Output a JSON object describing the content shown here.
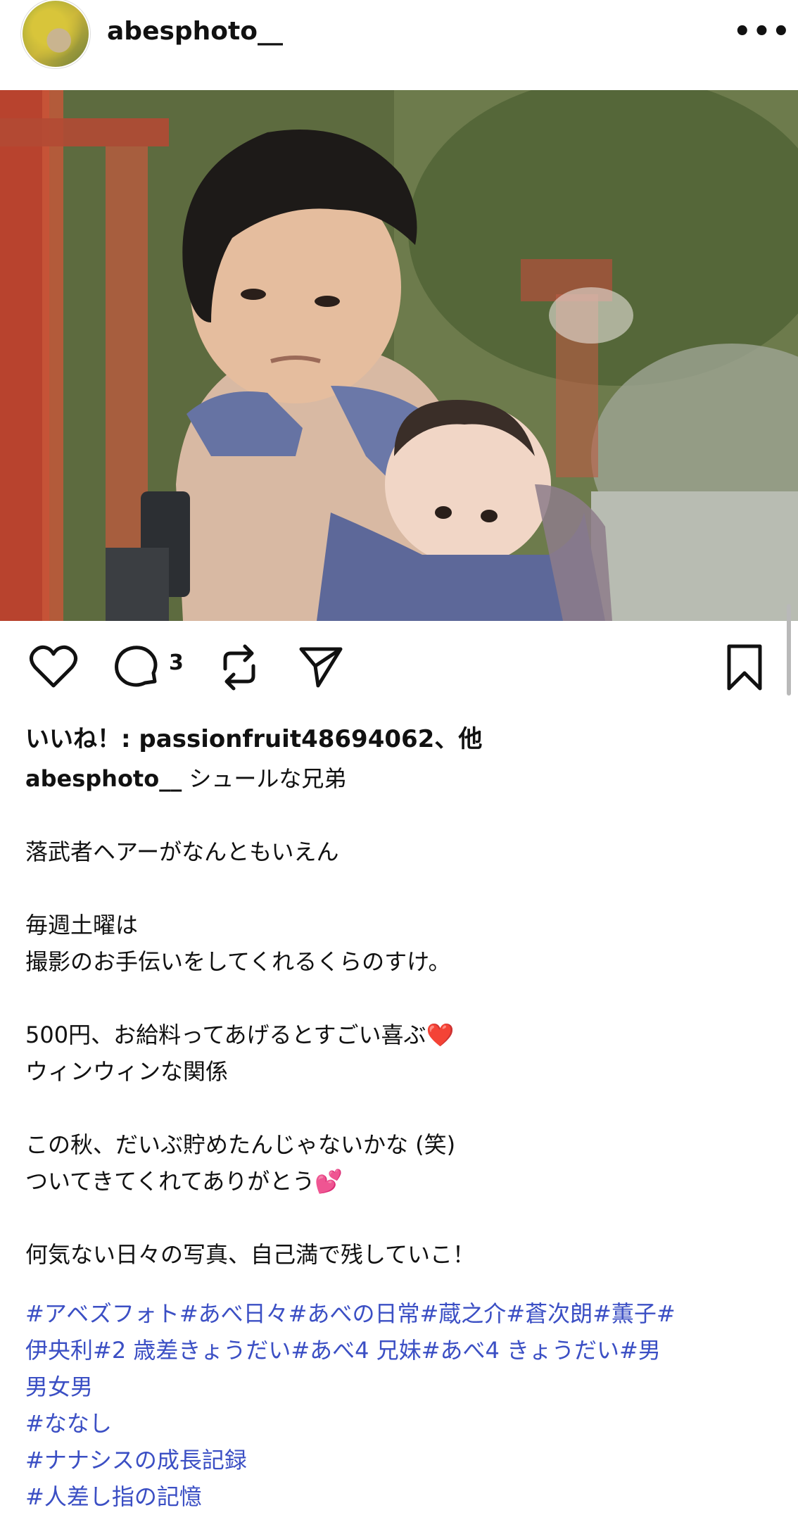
{
  "post": {
    "username": "abesphoto__",
    "more_icon": "more-dots-icon"
  },
  "actions": {
    "like_icon": "heart-icon",
    "comment_icon": "comment-icon",
    "comment_count": "3",
    "repost_icon": "repost-icon",
    "share_icon": "send-icon",
    "save_icon": "bookmark-icon"
  },
  "likes_text": "いいね！: passionfruit48694062、他",
  "caption": {
    "username": "abesphoto__",
    "first_line": "シュールな兄弟",
    "lines": [
      "落武者ヘアーがなんともいえん",
      "",
      "毎週土曜は",
      "撮影のお手伝いをしてくれるくらのすけ。",
      "",
      "500円、お給料ってあげるとすごい喜ぶ❤️",
      "ウィンウィンな関係",
      "",
      "この秋、だいぶ貯めたんじゃないかな (笑)",
      "ついてきてくれてありがとう💕",
      "",
      "何気ない日々の写真、自己満で残していこ！"
    ]
  },
  "hashtags": [
    "#アベズフォト#あべ日々#あべの日常#蔵之介#蒼次朗#薫子#",
    "伊央利#2 歳差きょうだい#あべ4 兄妹#あべ4 きょうだい#男",
    "男女男",
    "#ななし",
    "#ナナシスの成長記録",
    "#人差し指の記憶"
  ]
}
